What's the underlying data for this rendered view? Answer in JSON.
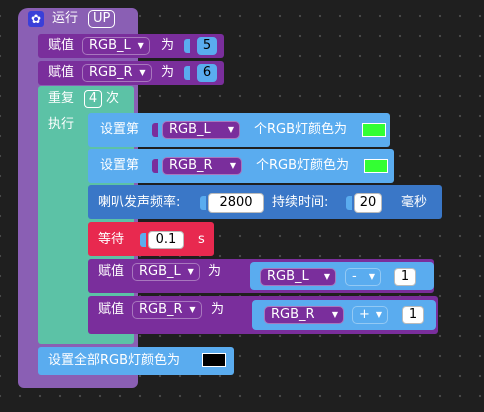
{
  "colors": {
    "event_purple": "#8a5fb4",
    "var_purple": "#7a2e9c",
    "loop_teal": "#5cc2a6",
    "led_blue": "#5aacef",
    "buzzer_blue": "#3a77c7",
    "wait_red": "#e8294f",
    "led_green": "#33ff33",
    "led_black": "#000000"
  },
  "run": {
    "label": "运行",
    "value": "UP",
    "icon": "gear-icon"
  },
  "assign1": {
    "label": "赋值",
    "var": "RGB_L",
    "to": "为",
    "value": "5"
  },
  "assign2": {
    "label": "赋值",
    "var": "RGB_R",
    "to": "为",
    "value": "6"
  },
  "repeat": {
    "label": "重复",
    "count": "4",
    "suffix": "次",
    "exec": "执行"
  },
  "set1": {
    "label": "设置第",
    "var": "RGB_L",
    "suffix": "个RGB灯颜色为",
    "color": "#33ff33"
  },
  "set2": {
    "label": "设置第",
    "var": "RGB_R",
    "suffix": "个RGB灯颜色为",
    "color": "#33ff33"
  },
  "buzzer": {
    "label": "喇叭发声频率:",
    "freq": "2800",
    "dur_label": "持续时间:",
    "dur": "20",
    "unit": "毫秒"
  },
  "wait": {
    "label": "等待",
    "value": "0.1",
    "unit": "s"
  },
  "assign3": {
    "label": "赋值",
    "var": "RGB_L",
    "to": "为",
    "var2": "RGB_L",
    "op": "-",
    "num": "1"
  },
  "assign4": {
    "label": "赋值",
    "var": "RGB_R",
    "to": "为",
    "var2": "RGB_R",
    "op": "+",
    "num": "1"
  },
  "setall": {
    "label": "设置全部RGB灯颜色为",
    "color": "#000000"
  },
  "dropdown_arrow": "▼"
}
